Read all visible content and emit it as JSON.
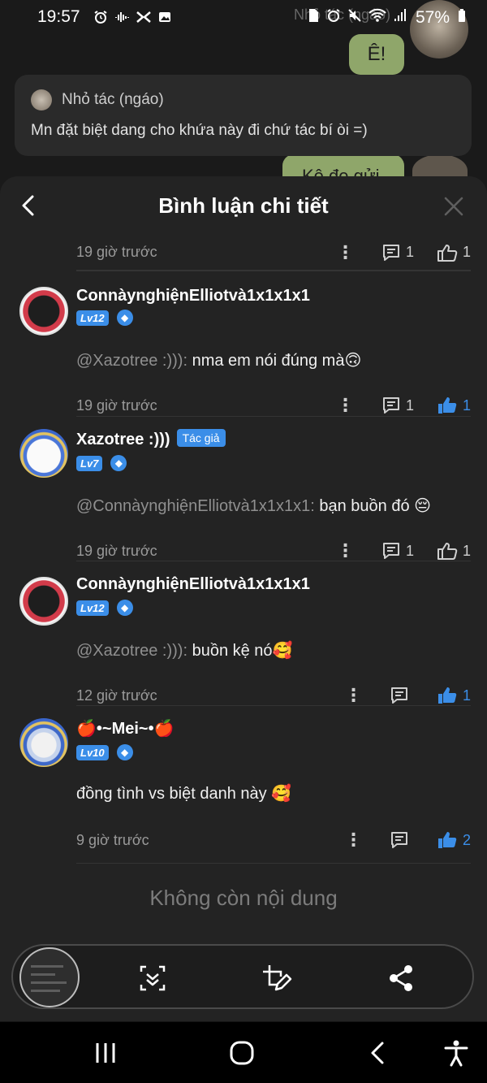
{
  "status_bar": {
    "time": "19:57",
    "battery": "57%",
    "left_icons": [
      "alarm-icon",
      "voice-icon",
      "screen-record-icon",
      "gallery-icon"
    ],
    "right_icons": [
      "sim-icon",
      "alarm-icon",
      "mute-icon",
      "wifi-icon",
      "signal-icon",
      "battery-icon"
    ]
  },
  "background_chat": {
    "ghost_sender": "Nhỏ tác (ngáo)",
    "bubble_1": "Ê!",
    "bubble_2": "Kệ đe gửi",
    "reply_card": {
      "name": "Nhỏ tác (ngáo)",
      "text": "Mn đặt biệt dang cho khứa này đi chứ tác bí òi =)"
    }
  },
  "sheet": {
    "title": "Bình luận chi tiết",
    "top_meta": {
      "time": "19 giờ trước",
      "comments": "1",
      "likes": "1",
      "liked": false
    },
    "comments": [
      {
        "username": "ConnàynghiệnElliotvà1x1x1x1",
        "level": "Lv12",
        "author_badge": "",
        "mention": "@Xazotree :))):",
        "text": " nma em nói đúng mà🙃",
        "time": "19 giờ trước",
        "comments": "1",
        "likes": "1",
        "liked": true
      },
      {
        "username": "Xazotree :)))",
        "level": "Lv7",
        "author_badge": "Tác giả",
        "mention": "@ConnàynghiệnElliotvà1x1x1x1:",
        "text": " bạn buồn đó 😔",
        "time": "19 giờ trước",
        "comments": "1",
        "likes": "1",
        "liked": false
      },
      {
        "username": "ConnàynghiệnElliotvà1x1x1x1",
        "level": "Lv12",
        "author_badge": "",
        "mention": "@Xazotree :))):",
        "text": " buồn kệ nó🥰",
        "time": "12 giờ trước",
        "comments": "",
        "likes": "1",
        "liked": true
      },
      {
        "username": "🍎•~Mei~•🍎",
        "level": "Lv10",
        "author_badge": "",
        "mention": "",
        "text": "đồng tình vs biệt danh này 🥰",
        "time": "9 giờ trước",
        "comments": "",
        "likes": "2",
        "liked": true
      }
    ],
    "empty_label": "Không còn nội dung"
  },
  "toolbar": {
    "buttons": [
      "screenshot-thumbnail",
      "scroll-capture-icon",
      "edit-crop-icon",
      "share-icon"
    ]
  },
  "navbar": {
    "buttons": [
      "recents-icon",
      "home-icon",
      "back-icon",
      "accessibility-icon"
    ]
  },
  "colors": {
    "accent": "#3b8ee8",
    "sheet_bg": "#232323",
    "bubble": "#8fa66a"
  }
}
